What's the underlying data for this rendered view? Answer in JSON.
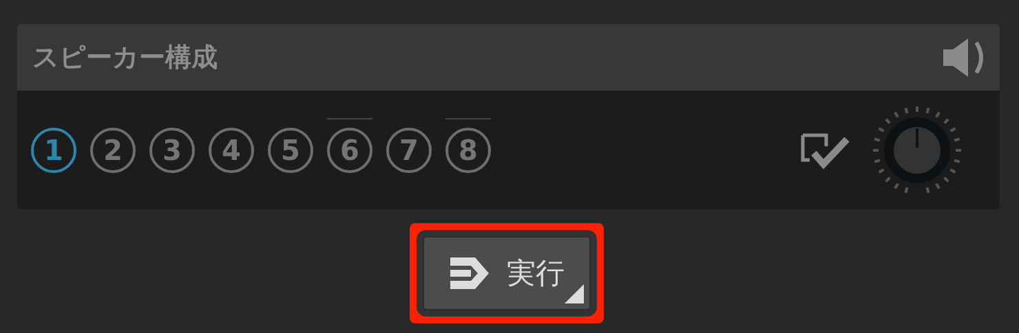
{
  "panel": {
    "title": "スピーカー構成"
  },
  "presets": [
    {
      "label": "1",
      "selected": true,
      "marked": false
    },
    {
      "label": "2",
      "selected": false,
      "marked": false
    },
    {
      "label": "3",
      "selected": false,
      "marked": false
    },
    {
      "label": "4",
      "selected": false,
      "marked": false
    },
    {
      "label": "5",
      "selected": false,
      "marked": false
    },
    {
      "label": "6",
      "selected": false,
      "marked": true
    },
    {
      "label": "7",
      "selected": false,
      "marked": false
    },
    {
      "label": "8",
      "selected": false,
      "marked": true
    }
  ],
  "check_toggle": {
    "checked": true
  },
  "run_button": {
    "label": "実行",
    "highlighted": true
  }
}
